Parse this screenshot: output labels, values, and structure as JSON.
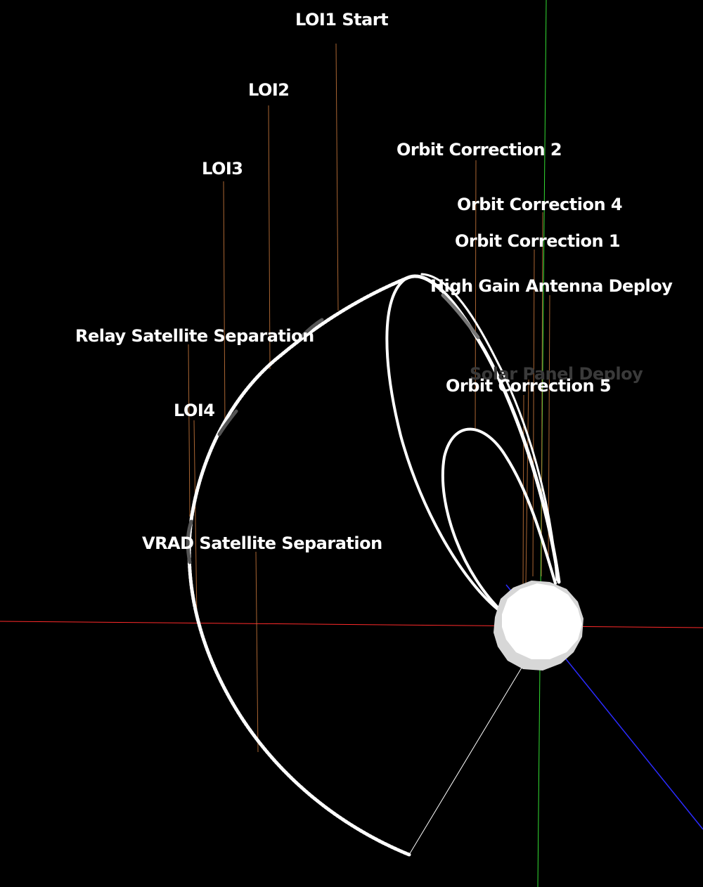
{
  "scene": {
    "background_color": "#000000",
    "orbit_color": "#ffffff",
    "marker_color": "#c8783c",
    "axes": {
      "x_axis_color": "#ff2a2a",
      "y_axis_color": "#33dd33",
      "z_axis_color": "#2b2bff"
    },
    "body_color": "#ffffff"
  },
  "events": [
    {
      "label": "LOI1 Start"
    },
    {
      "label": "LOI2"
    },
    {
      "label": "LOI3"
    },
    {
      "label": "Orbit Correction 2"
    },
    {
      "label": "Orbit Correction 4"
    },
    {
      "label": "Orbit Correction 1"
    },
    {
      "label": "High Gain Antenna Deploy"
    },
    {
      "label": "Relay Satellite Separation"
    },
    {
      "label": "Solar Panel Deploy"
    },
    {
      "label": "Orbit Correction 5"
    },
    {
      "label": "LOI4"
    },
    {
      "label": "VRAD Satellite Separation"
    }
  ]
}
